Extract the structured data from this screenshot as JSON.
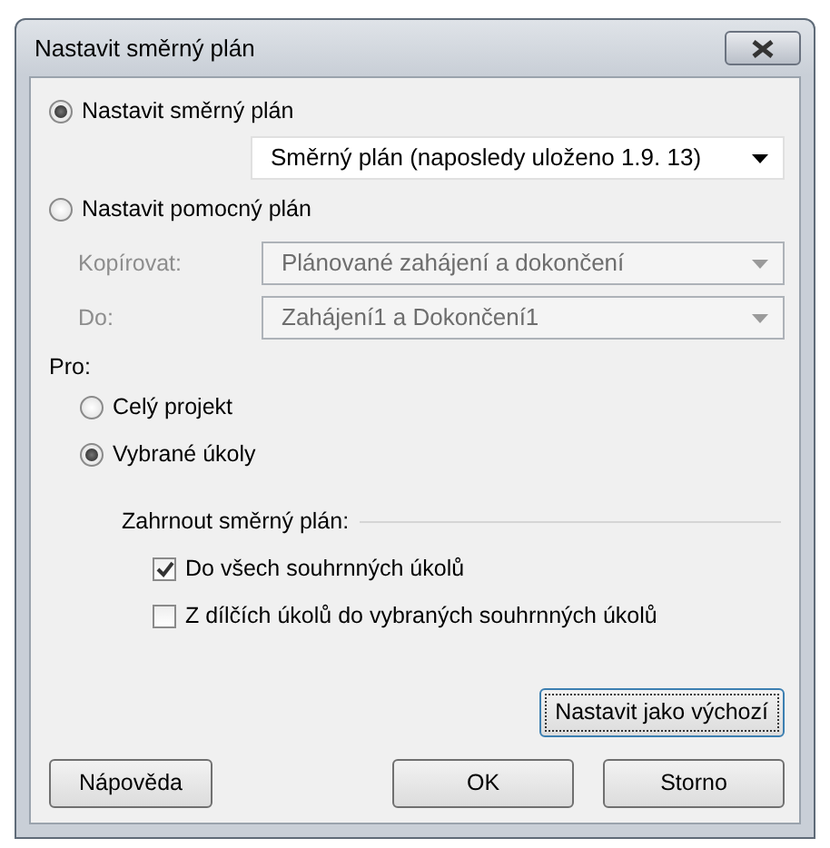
{
  "window": {
    "title": "Nastavit směrný plán"
  },
  "mode_options": [
    {
      "label": "Nastavit směrný plán",
      "selected": true
    },
    {
      "label": "Nastavit pomocný plán",
      "selected": false
    }
  ],
  "baseline_select": {
    "value": "Směrný plán (naposledy uloženo 1.9. 13)"
  },
  "interim_fields": [
    {
      "label": "Kopírovat:",
      "value": "Plánované zahájení a dokončení",
      "disabled": true
    },
    {
      "label": "Do:",
      "value": "Zahájení1 a Dokončení1",
      "disabled": true
    }
  ],
  "scope": {
    "label": "Pro:",
    "options": [
      {
        "label": "Celý projekt",
        "selected": false
      },
      {
        "label": "Vybrané úkoly",
        "selected": true
      }
    ]
  },
  "rollup": {
    "label": "Zahrnout směrný plán:",
    "options": [
      {
        "label": "Do všech souhrnných úkolů",
        "checked": true
      },
      {
        "label": "Z dílčích úkolů do vybraných souhrnných úkolů",
        "checked": false
      }
    ]
  },
  "default_button": {
    "label": "Nastavit jako výchozí"
  },
  "buttons": [
    {
      "label": "Nápověda",
      "kind": "help"
    },
    {
      "label": "OK",
      "kind": "action"
    },
    {
      "label": "Storno",
      "kind": "action"
    }
  ]
}
